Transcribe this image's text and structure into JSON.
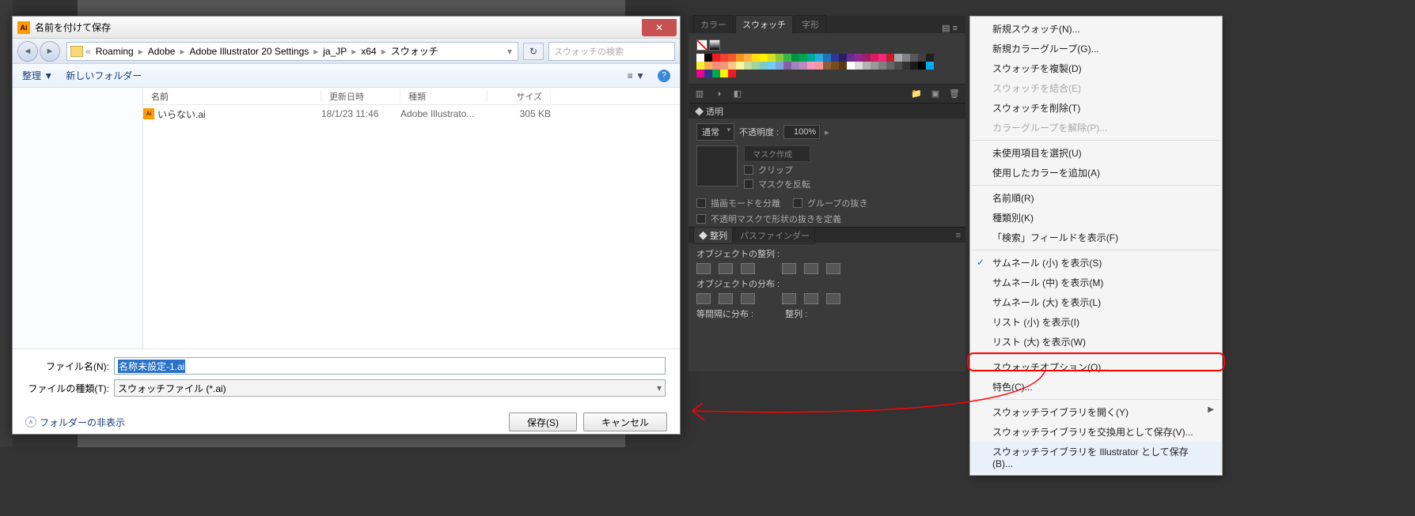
{
  "dialog": {
    "title": "名前を付けて保存",
    "path": [
      "Roaming",
      "Adobe",
      "Adobe Illustrator 20 Settings",
      "ja_JP",
      "x64",
      "スウォッチ"
    ],
    "search_placeholder": "スウォッチの検索",
    "toolbar": {
      "organize": "整理 ▼",
      "newfolder": "新しいフォルダー",
      "view": "≡ ▼"
    },
    "cols": {
      "name": "名前",
      "date": "更新日時",
      "type": "種類",
      "size": "サイズ"
    },
    "rows": [
      {
        "name": "いらない.ai",
        "date": "18/1/23 11:46",
        "type": "Adobe Illustrato...",
        "size": "305 KB"
      }
    ],
    "fields": {
      "filename_label": "ファイル名(N):",
      "filename_value": "名称未設定-1.ai",
      "filetype_label": "ファイルの種類(T):",
      "filetype_value": "スウォッチファイル (*.ai)"
    },
    "footer": {
      "hide": "フォルダーの非表示",
      "save": "保存(S)",
      "cancel": "キャンセル"
    }
  },
  "panel": {
    "tabs": [
      "カラー",
      "スウォッチ",
      "字形"
    ],
    "active_tab": 1,
    "swatch_colors": [
      "#ffffff",
      "#000000",
      "#ed1c24",
      "#ef4136",
      "#f15a29",
      "#f7941e",
      "#fbb040",
      "#ffde17",
      "#fff200",
      "#d7df23",
      "#8dc63f",
      "#39b54a",
      "#009444",
      "#00a651",
      "#00a99d",
      "#27aae1",
      "#1c75bc",
      "#2b3990",
      "#262262",
      "#662d91",
      "#92278f",
      "#9e1f63",
      "#da1c5c",
      "#ee2a7b",
      "#be1e2d",
      "#a7a9ac",
      "#808285",
      "#58595b",
      "#414042",
      "#231f20",
      "#f9ed32",
      "#fbb04e",
      "#f58e7d",
      "#f69679",
      "#fdc689",
      "#fff799",
      "#c4df9b",
      "#a3d39c",
      "#7accc8",
      "#6dcff6",
      "#7da7d9",
      "#8560a8",
      "#a186be",
      "#bd8cbf",
      "#f49ac1",
      "#f5989d",
      "#8b5e3c",
      "#754c24",
      "#603913",
      "#ffffff",
      "#dddddd",
      "#b3b3b3",
      "#999999",
      "#808080",
      "#666666",
      "#4d4d4d",
      "#333333",
      "#1a1a1a",
      "#000000",
      "#00aeef",
      "#ec008c",
      "#2e3192",
      "#00a651",
      "#fff200",
      "#ed1c24"
    ],
    "toolbar_icons": [
      "library",
      "show",
      "link",
      "new-group",
      "new-swatch",
      "delete"
    ],
    "transparency": {
      "tab": "◆ 透明",
      "mode": "通常",
      "opacity_label": "不透明度 :",
      "opacity_value": "100%",
      "mask_make": "マスク作成",
      "mask_clip": "クリップ",
      "mask_invert": "マスクを反転",
      "isolate": "描画モードを分離",
      "knockout": "グループの抜き",
      "define": "不透明マスクで形状の抜きを定義"
    },
    "align": {
      "tabs": [
        "◆ 整列",
        "パスファインダー"
      ],
      "active": 0,
      "align_label": "オブジェクトの整列 :",
      "dist_label": "オブジェクトの分布 :",
      "space_label": "等間隔に分布 :",
      "align_to_label": "整列 :"
    }
  },
  "menu": {
    "items": [
      {
        "label": "新規スウォッチ(N)..."
      },
      {
        "label": "新規カラーグループ(G)..."
      },
      {
        "label": "スウォッチを複製(D)"
      },
      {
        "label": "スウォッチを結合(E)",
        "dis": true
      },
      {
        "label": "スウォッチを削除(T)"
      },
      {
        "label": "カラーグループを解除(P)...",
        "dis": true
      },
      {
        "sep": true
      },
      {
        "label": "未使用項目を選択(U)"
      },
      {
        "label": "使用したカラーを追加(A)"
      },
      {
        "sep": true
      },
      {
        "label": "名前順(R)"
      },
      {
        "label": "種類別(K)"
      },
      {
        "label": "「検索」フィールドを表示(F)"
      },
      {
        "sep": true
      },
      {
        "label": "サムネール (小) を表示(S)",
        "checked": true
      },
      {
        "label": "サムネール (中) を表示(M)"
      },
      {
        "label": "サムネール (大) を表示(L)"
      },
      {
        "label": "リスト (小) を表示(I)"
      },
      {
        "label": "リスト (大) を表示(W)"
      },
      {
        "sep": true
      },
      {
        "label": "スウォッチオプション(O)..."
      },
      {
        "label": "特色(C)..."
      },
      {
        "sep": true
      },
      {
        "label": "スウォッチライブラリを開く(Y)",
        "sub": true
      },
      {
        "label": "スウォッチライブラリを交換用として保存(V)..."
      },
      {
        "label": "スウォッチライブラリを Illustrator として保存(B)...",
        "hl": true
      }
    ]
  }
}
